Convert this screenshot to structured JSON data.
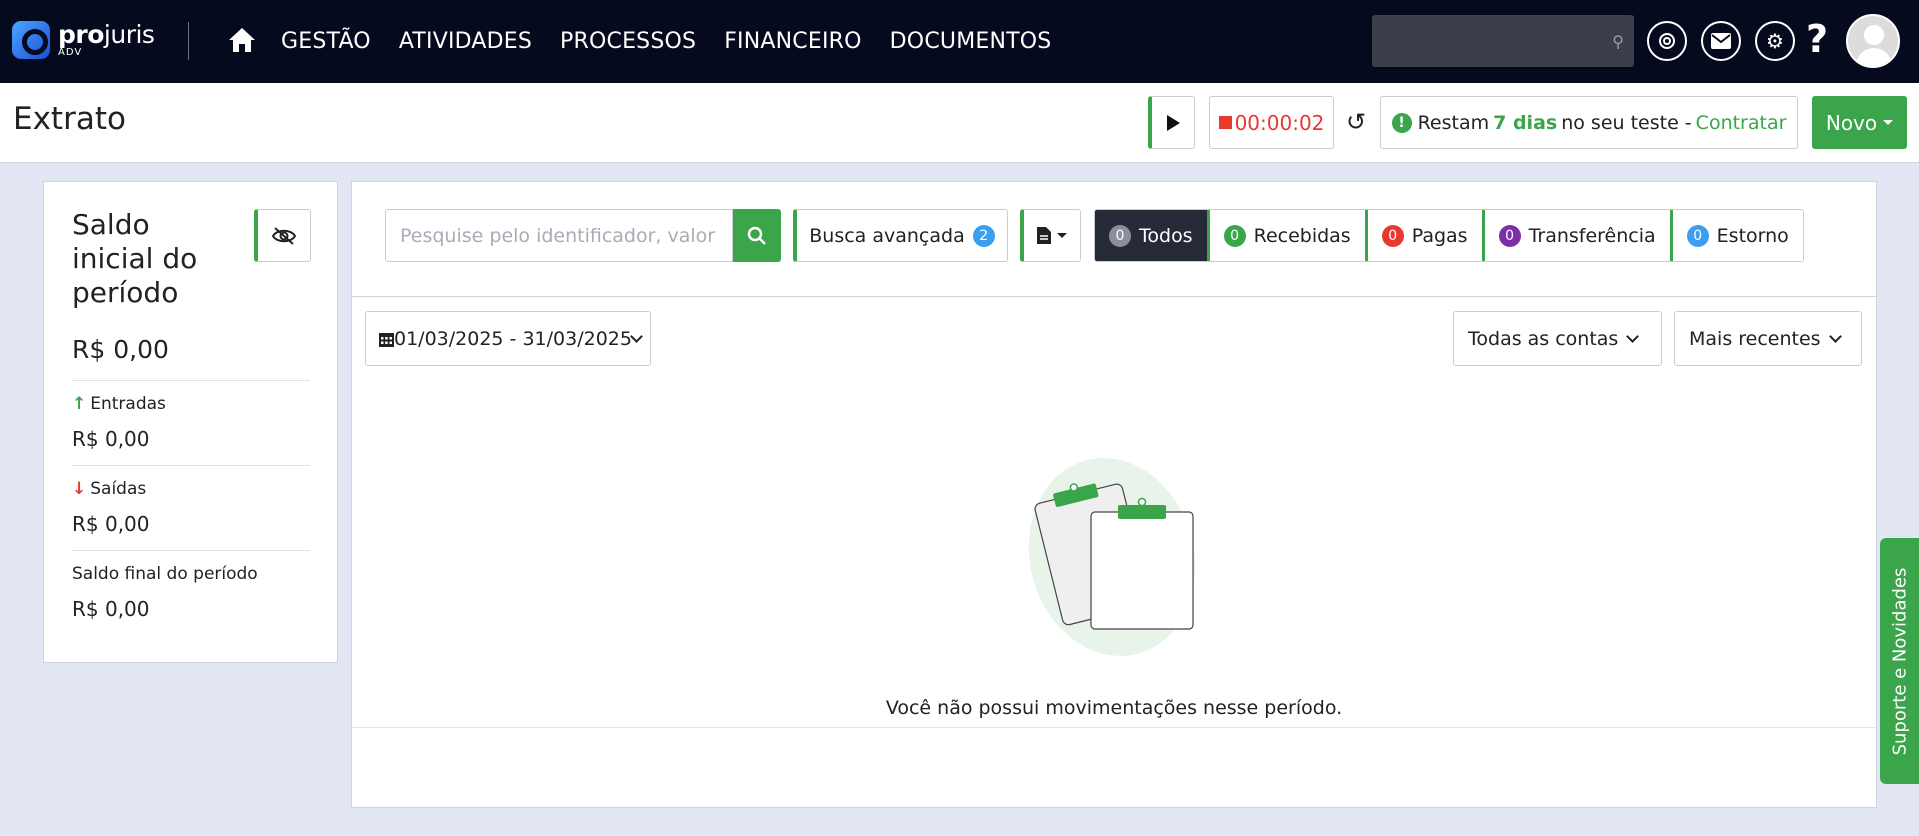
{
  "brand": {
    "name_bold": "pro",
    "name_rest": "juris",
    "sub": "ADV"
  },
  "nav": {
    "items": [
      "GESTÃO",
      "ATIVIDADES",
      "PROCESSOS",
      "FINANCEIRO",
      "DOCUMENTOS"
    ]
  },
  "header": {
    "title": "Extrato",
    "timer": "00:00:02",
    "trial_prefix": "Restam",
    "trial_days": "7 dias",
    "trial_suffix": "no seu teste -",
    "trial_link": "Contratar",
    "new_button": "Novo"
  },
  "summary": {
    "title": "Saldo inicial do período",
    "initial_value": "R$ 0,00",
    "entradas_label": "Entradas",
    "entradas_value": "R$ 0,00",
    "saidas_label": "Saídas",
    "saidas_value": "R$ 0,00",
    "final_label": "Saldo final do período",
    "final_value": "R$ 0,00"
  },
  "toolbar": {
    "search_placeholder": "Pesquise pelo identificador, valor",
    "advanced_label": "Busca avançada",
    "advanced_count": "2",
    "filters": [
      {
        "label": "Todos",
        "count": "0",
        "color": "#8a8f9c",
        "active": true
      },
      {
        "label": "Recebidas",
        "count": "0",
        "color": "#3aa54a",
        "active": false
      },
      {
        "label": "Pagas",
        "count": "0",
        "color": "#e8392f",
        "active": false
      },
      {
        "label": "Transferência",
        "count": "0",
        "color": "#7b2fa8",
        "active": false
      },
      {
        "label": "Estorno",
        "count": "0",
        "color": "#3c9ef0",
        "active": false
      }
    ]
  },
  "list": {
    "date_range": "01/03/2025 - 31/03/2025",
    "accounts_select": "Todas as contas",
    "sort_select": "Mais recentes",
    "empty_message": "Você não possui movimentações nesse período."
  },
  "support_tab": "Suporte e Novidades",
  "colors": {
    "accent": "#3aa54a",
    "topbar": "#060a1f",
    "danger": "#e8392f",
    "info": "#3c9ef0"
  }
}
